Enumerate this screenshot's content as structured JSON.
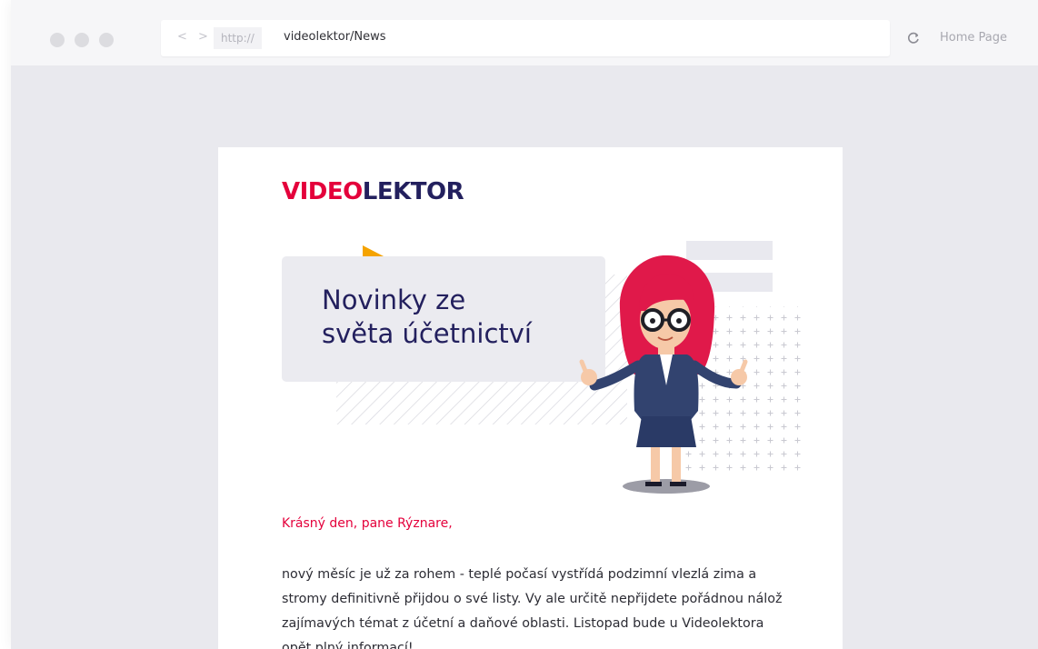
{
  "browser": {
    "nav_glyphs": "< >",
    "protocol": "http://",
    "url": "videolektor/News",
    "home_label": "Home Page"
  },
  "newsletter": {
    "logo_part1": "VIDEO",
    "logo_part2": "LEKTOR",
    "headline": "Novinky ze\nsvěta účetnictví",
    "greeting": "Krásný den, pane  Rýznare,",
    "body": "nový měsíc je už za rohem - teplé počasí vystřídá podzimní vlezlá zima a stromy definitivně přijdou o své listy. Vy ale určitě nepřijdete pořádnou nálož zajímavých témat z účetní a daňové oblasti. Listopad bude u Videolektora opět plný informací!"
  },
  "colors": {
    "brand_red": "#e4003b",
    "brand_navy": "#23205e",
    "accent_yellow": "#f5a300"
  }
}
